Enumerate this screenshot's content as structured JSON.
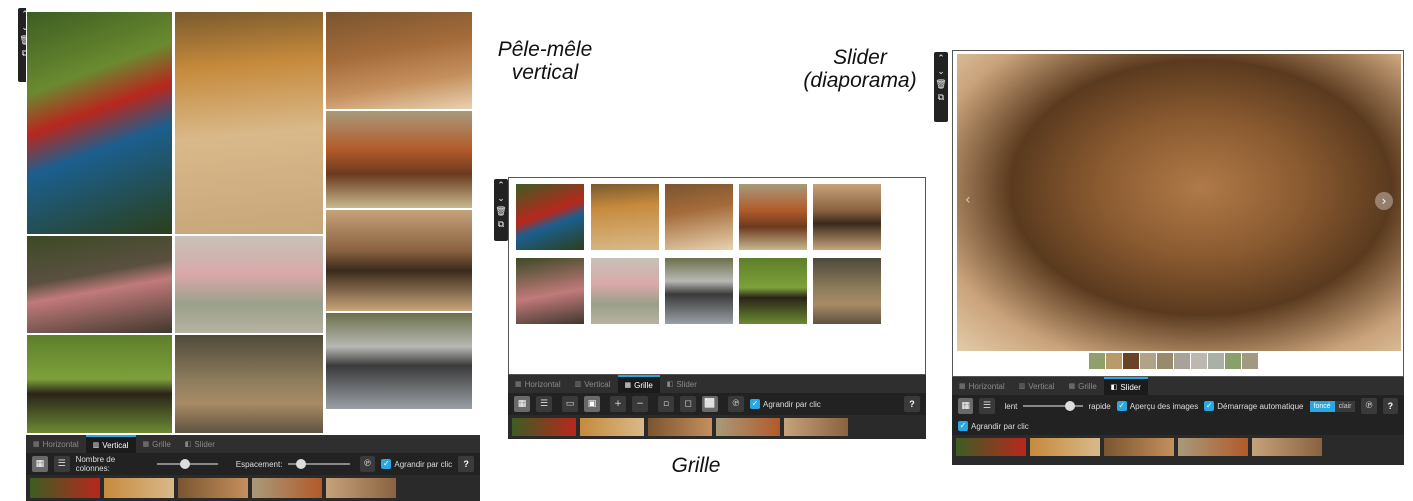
{
  "tabs": [
    {
      "icon": "horizontal-layout-icon",
      "label": "Horizontal"
    },
    {
      "icon": "vertical-layout-icon",
      "label": "Vertical"
    },
    {
      "icon": "grid-layout-icon",
      "label": "Grille"
    },
    {
      "icon": "slider-layout-icon",
      "label": "Slider"
    }
  ],
  "captions": {
    "vertical": "Pêle-mêle vertical",
    "vertical_l1": "Pêle-mêle",
    "vertical_l2": "vertical",
    "grid": "Grille",
    "slider_l1": "Slider",
    "slider_l2": "(diaporama)"
  },
  "vertical_panel": {
    "columns_label": "Nombre de colonnes:",
    "spacing_label": "Espacement:",
    "enlarge_label": "Agrandir par clic",
    "columns_level": 0.45,
    "spacing_level": 0.15
  },
  "grid_panel": {
    "enlarge_label": "Agrandir par clic"
  },
  "slider_panel": {
    "slow_label": "lent",
    "fast_label": "rapide",
    "speed_level": 0.85,
    "preview_label": "Aperçu des images",
    "autostart_label": "Démarrage automatique",
    "dark_label": "foncé",
    "light_label": "clair",
    "enlarge_label": "Agrandir par clic"
  },
  "help_label": "?",
  "colors": {
    "accent": "#2aa7e0",
    "panel": "#2a2a2a"
  }
}
